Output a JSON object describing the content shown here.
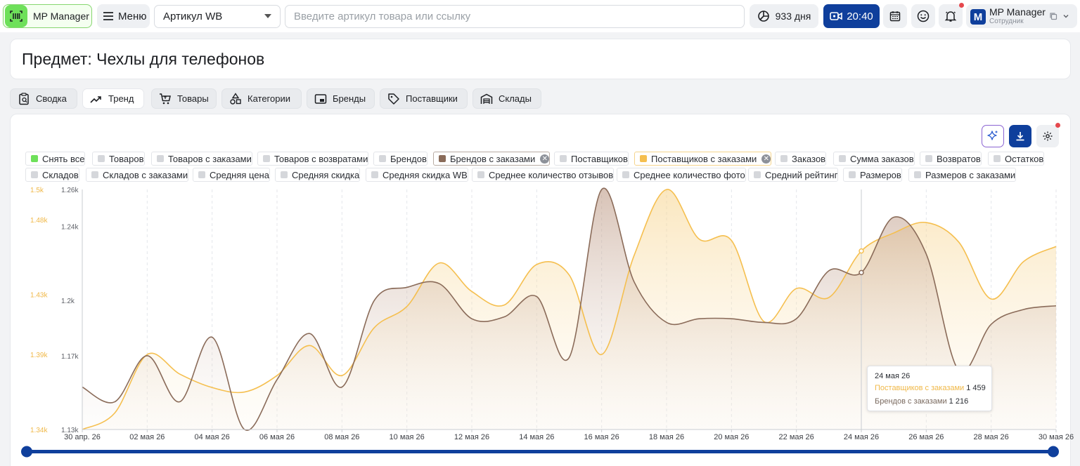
{
  "header": {
    "app_name": "MP Manager",
    "menu_label": "Меню",
    "article_select": "Артикул WB",
    "search_placeholder": "Введите артикул товара или ссылку",
    "days_label": "933 дня",
    "time_label": "20:40",
    "user_name": "MP Manager",
    "user_role": "Сотрудник",
    "user_initial": "M"
  },
  "page": {
    "title": "Предмет: Чехлы для телефонов"
  },
  "tabs": [
    {
      "label": "Сводка",
      "icon": "clipboard-icon",
      "active": false
    },
    {
      "label": "Тренд",
      "icon": "trend-icon",
      "active": true
    },
    {
      "label": "Товары",
      "icon": "cart-icon",
      "active": false
    },
    {
      "label": "Категории",
      "icon": "shapes-icon",
      "active": false
    },
    {
      "label": "Бренды",
      "icon": "brand-icon",
      "active": false
    },
    {
      "label": "Поставщики",
      "icon": "tag-icon",
      "active": false
    },
    {
      "label": "Склады",
      "icon": "warehouse-icon",
      "active": false
    }
  ],
  "metrics_row1": [
    {
      "label": "Снять все",
      "color": "#6ee05a",
      "removable": false
    },
    {
      "label": "Товаров",
      "color": "#d5d7db",
      "removable": false
    },
    {
      "label": "Товаров с заказами",
      "color": "#d5d7db",
      "removable": false
    },
    {
      "label": "Товаров с возвратами",
      "color": "#d5d7db",
      "removable": false
    },
    {
      "label": "Брендов",
      "color": "#d5d7db",
      "removable": false
    },
    {
      "label": "Брендов с заказами",
      "color": "#8a6b59",
      "removable": true
    },
    {
      "label": "Поставщиков",
      "color": "#d5d7db",
      "removable": false
    },
    {
      "label": "Поставщиков с заказами",
      "color": "#f5bf4f",
      "removable": true
    },
    {
      "label": "Заказов",
      "color": "#d5d7db",
      "removable": false
    },
    {
      "label": "Сумма заказов",
      "color": "#d5d7db",
      "removable": false
    },
    {
      "label": "Возвратов",
      "color": "#d5d7db",
      "removable": false
    },
    {
      "label": "Остатков",
      "color": "#d5d7db",
      "removable": false
    }
  ],
  "metrics_row2": [
    {
      "label": "Складов",
      "color": "#d5d7db"
    },
    {
      "label": "Складов с заказами",
      "color": "#d5d7db"
    },
    {
      "label": "Средняя цена",
      "color": "#d5d7db"
    },
    {
      "label": "Средняя скидка",
      "color": "#d5d7db"
    },
    {
      "label": "Средняя скидка WB",
      "color": "#d5d7db"
    },
    {
      "label": "Среднее количество отзывов",
      "color": "#d5d7db"
    },
    {
      "label": "Среднее количество фото",
      "color": "#d5d7db"
    },
    {
      "label": "Средний рейтинг",
      "color": "#d5d7db"
    },
    {
      "label": "Размеров",
      "color": "#d5d7db"
    },
    {
      "label": "Размеров с заказами",
      "color": "#d5d7db"
    }
  ],
  "chart_data": {
    "type": "area",
    "x": [
      "30 апр. 26",
      "01 мая 26",
      "02 мая 26",
      "03 мая 26",
      "04 мая 26",
      "05 мая 26",
      "06 мая 26",
      "07 мая 26",
      "08 мая 26",
      "09 мая 26",
      "10 мая 26",
      "11 мая 26",
      "12 мая 26",
      "13 мая 26",
      "14 мая 26",
      "15 мая 26",
      "16 мая 26",
      "17 мая 26",
      "18 мая 26",
      "19 мая 26",
      "20 мая 26",
      "21 мая 26",
      "22 мая 26",
      "23 мая 26",
      "24 мая 26",
      "25 мая 26",
      "26 мая 26",
      "27 мая 26",
      "28 мая 26",
      "29 мая 26",
      "30 мая 26"
    ],
    "x_tick_labels": [
      "30 апр. 26",
      "02 мая 26",
      "04 мая 26",
      "06 мая 26",
      "08 мая 26",
      "10 мая 26",
      "12 мая 26",
      "14 мая 26",
      "16 мая 26",
      "18 мая 26",
      "20 мая 26",
      "22 мая 26",
      "24 мая 26",
      "26 мая 26",
      "28 мая 26",
      "30 мая 26"
    ],
    "series": [
      {
        "name": "Поставщиков с заказами",
        "axis": "left",
        "color": "#f5bf4f",
        "values": [
          1340,
          1351,
          1390,
          1377,
          1368,
          1365,
          1376,
          1396,
          1376,
          1408,
          1422,
          1451,
          1432,
          1423,
          1450,
          1443,
          1390,
          1456,
          1500,
          1467,
          1466,
          1412,
          1434,
          1428,
          1459,
          1471,
          1478,
          1465,
          1427,
          1452,
          1462
        ]
      },
      {
        "name": "Брендов с заказами",
        "axis": "right",
        "color": "#8a6b59",
        "values": [
          1.153,
          1.145,
          1.17,
          1.145,
          1.18,
          1.13,
          1.157,
          1.182,
          1.153,
          1.2,
          1.207,
          1.209,
          1.19,
          1.191,
          1.202,
          1.169,
          1.26,
          1.21,
          1.188,
          1.19,
          1.19,
          1.188,
          1.19,
          1.216,
          1.215,
          1.245,
          1.225,
          1.162,
          1.187,
          1.195,
          1.197
        ]
      }
    ],
    "y_left": {
      "ticks": [
        "1.34k",
        "1.39k",
        "1.43k",
        "1.48k",
        "1.5k"
      ],
      "ylim": [
        1340,
        1500
      ],
      "color": "#f0b848"
    },
    "y_right": {
      "ticks": [
        "1.13k",
        "1.17k",
        "1.2k",
        "1.24k",
        "1.26k"
      ],
      "ylim": [
        1130,
        1260
      ],
      "color": "#5c5f66"
    },
    "grid": true,
    "tooltip": {
      "date": "24 мая 26",
      "line1_label": "Поставщиков с заказами",
      "line1_value": "1 459",
      "line2_label": "Брендов с заказами",
      "line2_value": "1 216"
    }
  }
}
